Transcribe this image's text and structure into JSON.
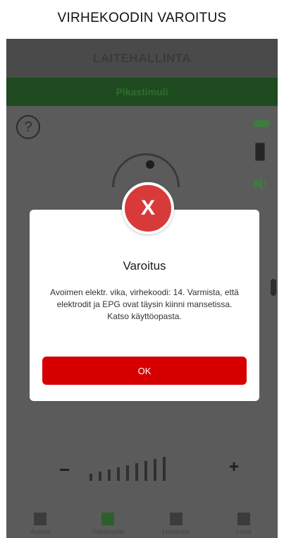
{
  "caption": "VIRHEKOODIN VAROITUS",
  "app": {
    "header_title": "LAITEHALLINTA",
    "tab_label": "Pikastimuli",
    "help_symbol": "?",
    "level_minus": "−",
    "level_plus": "+",
    "nav": [
      {
        "label": "Asetus",
        "icon": "device-icon"
      },
      {
        "label": "Toimenpide",
        "icon": "list-icon"
      },
      {
        "label": "Lisätiedot",
        "icon": "chart-icon"
      },
      {
        "label": "Lisää",
        "icon": "more-icon"
      }
    ]
  },
  "dialog": {
    "badge_symbol": "X",
    "title": "Varoitus",
    "message": "Avoimen elektr. vika, virhekoodi: 14. Varmista, että elektrodit ja EPG ovat täysin kiinni mansetissa. Katso käyttöopasta.",
    "ok_label": "OK"
  },
  "colors": {
    "overlay": "#5b5b5b",
    "header": "#4a4a4a",
    "tab": "#1f4a1f",
    "error_red": "#d83a3a",
    "ok_red": "#d60000"
  }
}
